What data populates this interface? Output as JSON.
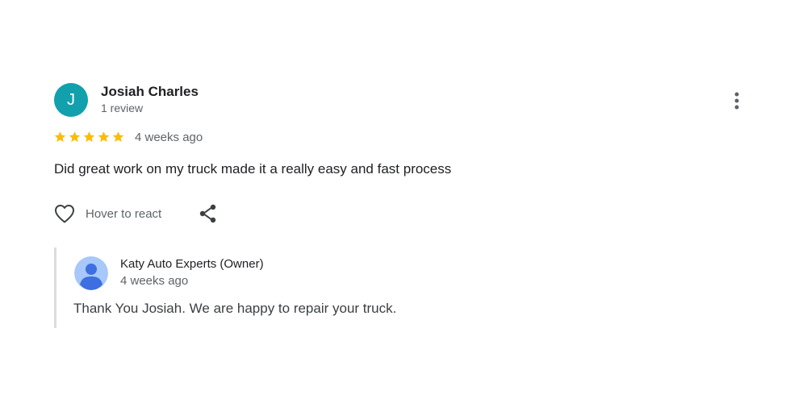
{
  "review": {
    "avatar_letter": "J",
    "avatar_color": "#12a0ad",
    "reviewer_name": "Josiah Charles",
    "review_count": "1 review",
    "rating": 5,
    "rating_max": 5,
    "star_color": "#fbbc04",
    "date": "4 weeks ago",
    "text": "Did great work on my truck made it a really easy and fast process",
    "more_options_icon": "more-vertical-icon",
    "react_label": "Hover to react",
    "react_icon": "heart-outline-icon",
    "share_icon": "share-icon"
  },
  "owner_reply": {
    "name": "Katy Auto Experts (Owner)",
    "date": "4 weeks ago",
    "text": "Thank You Josiah. We are happy to repair your truck.",
    "avatar_icon": "default-user-avatar-icon",
    "avatar_bg_color": "#a8c7fa",
    "avatar_fg_color": "#3d6fe0"
  }
}
